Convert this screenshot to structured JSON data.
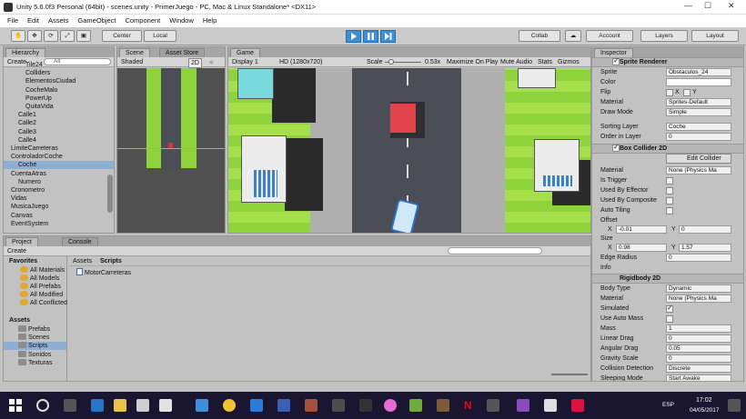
{
  "window": {
    "title": "Unity 5.6.0f3 Personal (64bit) - scenes.unity - PrimerJuego - PC, Mac & Linux Standalone* <DX11>"
  },
  "menu": [
    "File",
    "Edit",
    "Assets",
    "GameObject",
    "Component",
    "Window",
    "Help"
  ],
  "toolbar": {
    "center": "Center",
    "local": "Local",
    "collab": "Collab",
    "account": "Account",
    "layers": "Layers",
    "layout": "Layout"
  },
  "hierarchy": {
    "tab": "Hierarchy",
    "create": "Create",
    "search": "All",
    "items": [
      {
        "label": "Tile24",
        "indent": 3
      },
      {
        "label": "Colliders",
        "indent": 3
      },
      {
        "label": "ElementosCiudad",
        "indent": 3
      },
      {
        "label": "CocheMalo",
        "indent": 3
      },
      {
        "label": "PowerUp",
        "indent": 3
      },
      {
        "label": "QuitaVida",
        "indent": 3
      },
      {
        "label": "Calle1",
        "indent": 2
      },
      {
        "label": "Calle2",
        "indent": 2
      },
      {
        "label": "Calle3",
        "indent": 2
      },
      {
        "label": "Calle4",
        "indent": 2
      },
      {
        "label": "LimiteCarreteras",
        "indent": 1
      },
      {
        "label": "ControladorCoche",
        "indent": 1
      },
      {
        "label": "Coche",
        "indent": 2
      },
      {
        "label": "CuentaAtras",
        "indent": 1
      },
      {
        "label": "Numero",
        "indent": 2
      },
      {
        "label": "Cronometro",
        "indent": 1
      },
      {
        "label": "Vidas",
        "indent": 1
      },
      {
        "label": "MusicaJuego",
        "indent": 1
      },
      {
        "label": "Canvas",
        "indent": 1
      },
      {
        "label": "EventSystem",
        "indent": 1
      }
    ]
  },
  "scene": {
    "tab_scene": "Scene",
    "tab_store": "Asset Store",
    "shaded": "Shaded",
    "mode2d": "2D"
  },
  "game": {
    "tab": "Game",
    "display": "Display 1",
    "resolution": "HD (1280x720)",
    "scale_label": "Scale",
    "scale_value": "0.53x",
    "maximize": "Maximize On Play",
    "mute": "Mute Audio",
    "stats": "Stats",
    "gizmos": "Gizmos"
  },
  "project": {
    "tab_project": "Project",
    "tab_console": "Console",
    "create": "Create",
    "favorites_title": "Favorites",
    "favorites": [
      "All Materials",
      "All Models",
      "All Prefabs",
      "All Modified",
      "All Conflicted"
    ],
    "assets_title": "Assets",
    "folders": [
      "Prefabs",
      "Scenes",
      "Scripts",
      "Sonidos",
      "Texturas"
    ],
    "breadcrumb": [
      "Assets",
      "Scripts"
    ],
    "files": [
      "MotorCarreteras"
    ]
  },
  "inspector": {
    "tab": "Inspector",
    "sprite_renderer": {
      "title": "Sprite Renderer",
      "sprite_label": "Sprite",
      "sprite_value": "Obstaculos_24",
      "color_label": "Color",
      "flip_label": "Flip",
      "flip_x": "X",
      "flip_y": "Y",
      "material_label": "Material",
      "material_value": "Sprites-Default",
      "draw_mode_label": "Draw Mode",
      "draw_mode_value": "Simple",
      "sorting_layer_label": "Sorting Layer",
      "sorting_layer_value": "Coche",
      "order_label": "Order in Layer",
      "order_value": "0"
    },
    "box_collider": {
      "title": "Box Collider 2D",
      "edit_collider": "Edit Collider",
      "material_label": "Material",
      "material_value": "None (Physics Ma",
      "is_trigger": "Is Trigger",
      "used_by_effector": "Used By Effector",
      "used_by_composite": "Used By Composite",
      "auto_tiling": "Auto Tiling",
      "offset_label": "Offset",
      "offset_x": "-0.01",
      "offset_y": "0",
      "size_label": "Size",
      "size_x": "0.98",
      "size_y": "1.57",
      "edge_radius_label": "Edge Radius",
      "edge_radius_value": "0",
      "info_label": "Info"
    },
    "rigidbody": {
      "title": "Rigidbody 2D",
      "body_type_label": "Body Type",
      "body_type_value": "Dynamic",
      "material_label": "Material",
      "material_value": "None (Physics Ma",
      "simulated_label": "Simulated",
      "use_auto_mass_label": "Use Auto Mass",
      "mass_label": "Mass",
      "mass_value": "1",
      "linear_drag_label": "Linear Drag",
      "linear_drag_value": "0",
      "angular_drag_label": "Angular Drag",
      "angular_drag_value": "0.05",
      "gravity_scale_label": "Gravity Scale",
      "gravity_scale_value": "0",
      "collision_detection_label": "Collision Detection",
      "collision_detection_value": "Discrete",
      "sleeping_mode_label": "Sleeping Mode",
      "sleeping_mode_value": "Start Awake"
    }
  },
  "taskbar": {
    "language": "ESP",
    "time": "17:02",
    "date": "04/05/2017"
  },
  "colors": {
    "play_button": "#3d8fd6",
    "selection": "#8faed3",
    "grass": "#8ed23c",
    "road": "#4b4d57"
  }
}
